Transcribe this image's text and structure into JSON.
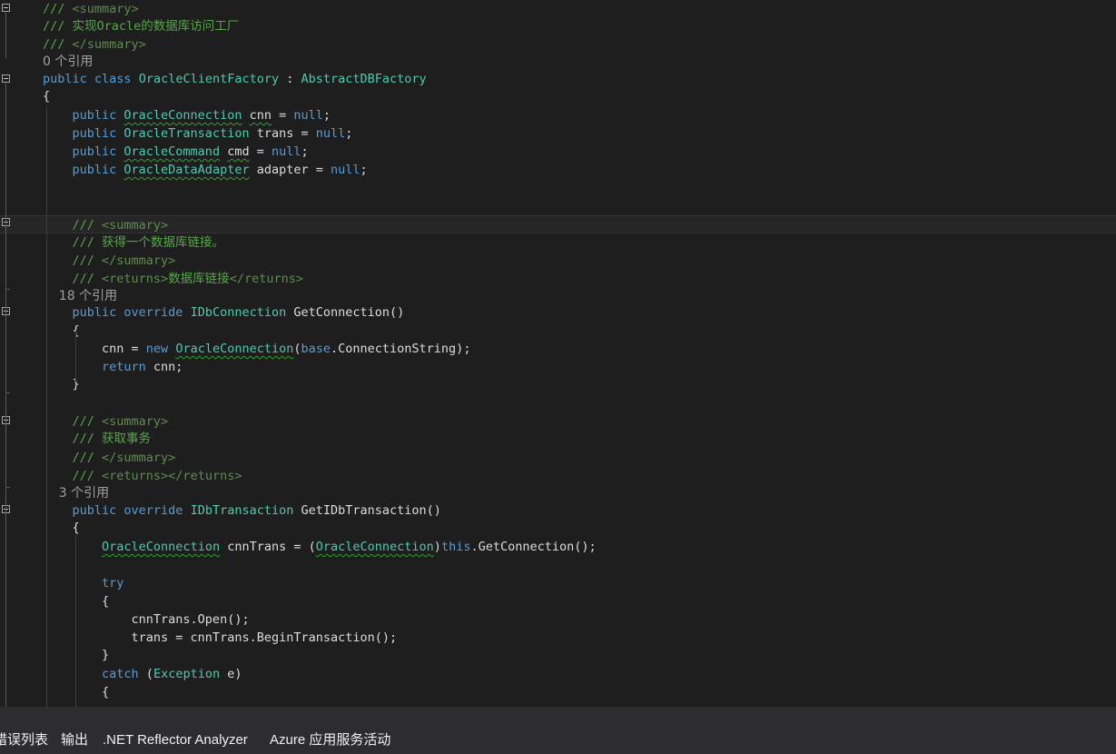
{
  "editor": {
    "lines": [
      {
        "tokens": [
          [
            "/// ",
            "comment"
          ],
          [
            "<summary>",
            "xml"
          ]
        ]
      },
      {
        "tokens": [
          [
            "/// 实现Oracle的数据库访问工厂",
            "comment"
          ]
        ]
      },
      {
        "tokens": [
          [
            "/// ",
            "comment"
          ],
          [
            "</summary>",
            "xml"
          ]
        ]
      },
      {
        "lens": "0 个引用"
      },
      {
        "tokens": [
          [
            "public ",
            "kw"
          ],
          [
            "class ",
            "kw"
          ],
          [
            "OracleClientFactory",
            "type"
          ],
          [
            " : ",
            "plain"
          ],
          [
            "AbstractDBFactory",
            "type"
          ]
        ]
      },
      {
        "tokens": [
          [
            "{",
            "plain"
          ]
        ]
      },
      {
        "tokens": [
          [
            "    public ",
            "kw"
          ],
          [
            "OracleConnection",
            "type",
            "sq"
          ],
          [
            " ",
            "plain"
          ],
          [
            "cnn",
            "plain",
            "sq"
          ],
          [
            " = ",
            "plain"
          ],
          [
            "null",
            "kw"
          ],
          [
            ";",
            "plain"
          ]
        ]
      },
      {
        "tokens": [
          [
            "    public ",
            "kw"
          ],
          [
            "OracleTransaction",
            "type"
          ],
          [
            " trans = ",
            "plain"
          ],
          [
            "null",
            "kw"
          ],
          [
            ";",
            "plain"
          ]
        ]
      },
      {
        "tokens": [
          [
            "    public ",
            "kw"
          ],
          [
            "OracleCommand",
            "type",
            "sq"
          ],
          [
            " ",
            "plain"
          ],
          [
            "cmd",
            "plain",
            "sq"
          ],
          [
            " = ",
            "plain"
          ],
          [
            "null",
            "kw"
          ],
          [
            ";",
            "plain"
          ]
        ]
      },
      {
        "tokens": [
          [
            "    public ",
            "kw"
          ],
          [
            "OracleDataAdapter",
            "type",
            "sq"
          ],
          [
            " adapter = ",
            "plain"
          ],
          [
            "null",
            "kw"
          ],
          [
            ";",
            "plain"
          ]
        ]
      },
      {
        "tokens": []
      },
      {
        "tokens": []
      },
      {
        "current": true,
        "tokens": [
          [
            "    /// ",
            "comment"
          ],
          [
            "<summary>",
            "xml"
          ]
        ]
      },
      {
        "tokens": [
          [
            "    /// 获得一个数据库链接。",
            "comment"
          ]
        ]
      },
      {
        "tokens": [
          [
            "    /// ",
            "comment"
          ],
          [
            "</summary>",
            "xml"
          ]
        ]
      },
      {
        "tokens": [
          [
            "    /// ",
            "comment"
          ],
          [
            "<returns>",
            "xml"
          ],
          [
            "数据库链接",
            "comment"
          ],
          [
            "</returns>",
            "xml"
          ]
        ]
      },
      {
        "lens": "    18 个引用"
      },
      {
        "tokens": [
          [
            "    public ",
            "kw"
          ],
          [
            "override ",
            "kw"
          ],
          [
            "IDbConnection",
            "type"
          ],
          [
            " GetConnection()",
            "plain"
          ]
        ]
      },
      {
        "tokens": [
          [
            "    {",
            "plain"
          ]
        ]
      },
      {
        "tokens": [
          [
            "        cnn = ",
            "plain"
          ],
          [
            "new ",
            "kw"
          ],
          [
            "OracleConnection",
            "type",
            "sq"
          ],
          [
            "(",
            "plain"
          ],
          [
            "base",
            "kw"
          ],
          [
            ".ConnectionString);",
            "plain"
          ]
        ]
      },
      {
        "tokens": [
          [
            "        return ",
            "kw"
          ],
          [
            "cnn;",
            "plain"
          ]
        ]
      },
      {
        "tokens": [
          [
            "    }",
            "plain"
          ]
        ]
      },
      {
        "tokens": []
      },
      {
        "tokens": [
          [
            "    /// ",
            "comment"
          ],
          [
            "<summary>",
            "xml"
          ]
        ]
      },
      {
        "tokens": [
          [
            "    /// 获取事务",
            "comment"
          ]
        ]
      },
      {
        "tokens": [
          [
            "    /// ",
            "comment"
          ],
          [
            "</summary>",
            "xml"
          ]
        ]
      },
      {
        "tokens": [
          [
            "    /// ",
            "comment"
          ],
          [
            "<returns></returns>",
            "xml"
          ]
        ]
      },
      {
        "lens": "    3 个引用"
      },
      {
        "tokens": [
          [
            "    public ",
            "kw"
          ],
          [
            "override ",
            "kw"
          ],
          [
            "IDbTransaction",
            "type"
          ],
          [
            " GetIDbTransaction()",
            "plain"
          ]
        ]
      },
      {
        "tokens": [
          [
            "    {",
            "plain"
          ]
        ]
      },
      {
        "tokens": [
          [
            "        ",
            "plain"
          ],
          [
            "OracleConnection",
            "type",
            "sq"
          ],
          [
            " cnnTrans = (",
            "plain"
          ],
          [
            "OracleConnection",
            "type",
            "sq"
          ],
          [
            ")",
            "plain"
          ],
          [
            "this",
            "kw"
          ],
          [
            ".GetConnection();",
            "plain"
          ]
        ]
      },
      {
        "tokens": []
      },
      {
        "tokens": [
          [
            "        try",
            "kw"
          ]
        ]
      },
      {
        "tokens": [
          [
            "        {",
            "plain"
          ]
        ]
      },
      {
        "tokens": [
          [
            "            cnnTrans.Open();",
            "plain"
          ]
        ]
      },
      {
        "tokens": [
          [
            "            trans = cnnTrans.BeginTransaction();",
            "plain"
          ]
        ]
      },
      {
        "tokens": [
          [
            "        }",
            "plain"
          ]
        ]
      },
      {
        "tokens": [
          [
            "        catch ",
            "kw"
          ],
          [
            "(",
            "plain"
          ],
          [
            "Exception",
            "type"
          ],
          [
            " e)",
            "plain"
          ]
        ]
      },
      {
        "tokens": [
          [
            "        {",
            "plain"
          ]
        ]
      }
    ]
  },
  "tabs": [
    {
      "label": "错误列表"
    },
    {
      "label": "输出"
    },
    {
      "label": ".NET Reflector Analyzer"
    },
    {
      "label": "Azure 应用服务活动"
    }
  ]
}
